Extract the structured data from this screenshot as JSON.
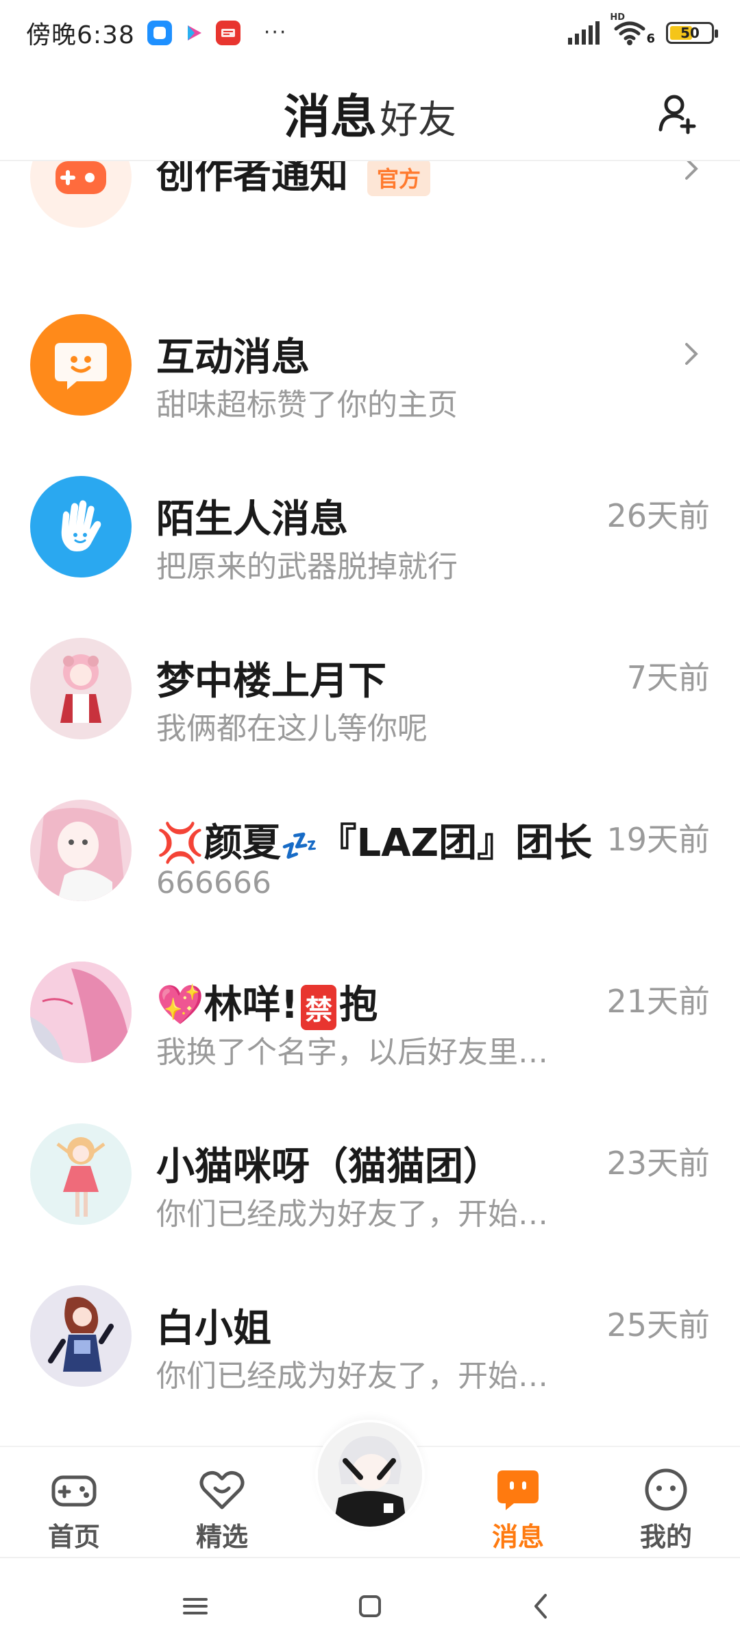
{
  "status_bar": {
    "time": "傍晚6:38",
    "more": "···",
    "network": "HD",
    "wifi_sub": "6",
    "battery": "50"
  },
  "header": {
    "active_tab": "消息",
    "inactive_tab": "好友"
  },
  "rows": [
    {
      "name": "创作者通知",
      "badge": "官方",
      "preview": "",
      "time": "",
      "avatar_icon": "game-controller-icon"
    },
    {
      "name": "互动消息",
      "preview": "甜味超标赞了你的主页",
      "time": "",
      "avatar_icon": "smile-bubble-icon"
    },
    {
      "name": "陌生人消息",
      "preview": "把原来的武器脱掉就行",
      "time": "26天前",
      "avatar_icon": "hand-wave-icon"
    },
    {
      "name": "梦中楼上月下",
      "preview": "我俩都在这儿等你呢",
      "time": "7天前"
    },
    {
      "name_pre": "💢",
      "name": "颜夏",
      "name_mid": "💤",
      "name_post": "『LAZ团』团长",
      "preview": "666666",
      "time": "19天前"
    },
    {
      "name_pre": "💖",
      "name": "林咩!",
      "name_mid": "禁",
      "name_post": "抱",
      "preview": "我换了个名字，以后好友里…",
      "time": "21天前"
    },
    {
      "name": "小猫咪呀（猫猫团）",
      "preview": "你们已经成为好友了，开始…",
      "time": "23天前"
    },
    {
      "name": "白小姐",
      "preview": "你们已经成为好友了，开始…",
      "time": "25天前"
    }
  ],
  "bottom_nav": [
    {
      "label": "首页",
      "icon": "gamepad-icon"
    },
    {
      "label": "精选",
      "icon": "heart-icon"
    },
    {
      "label": "消息",
      "icon": "message-icon",
      "active": true
    },
    {
      "label": "我的",
      "icon": "face-icon"
    }
  ],
  "colors": {
    "accent": "#ff7a0f",
    "muted_text": "#9a9a9a",
    "official_bg": "#fde6d6"
  }
}
